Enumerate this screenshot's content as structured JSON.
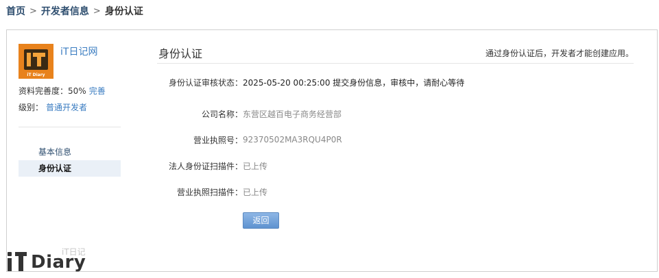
{
  "breadcrumb": {
    "home": "首页",
    "developer_info": "开发者信息",
    "current": "身份认证"
  },
  "sidebar": {
    "site_name": "iT日记网",
    "avatar_caption": "iT Diary",
    "completeness_label": "资料完善度：",
    "completeness_value": "50%",
    "completeness_link": "完善",
    "level_label": "级别：",
    "level_value": "普通开发者",
    "nav": [
      {
        "label": "基本信息",
        "active": false
      },
      {
        "label": "身份认证",
        "active": true
      }
    ]
  },
  "main": {
    "title": "身份认证",
    "note": "通过身份认证后，开发者才能创建应用。",
    "fields": {
      "status_label": "身份认证审核状态：",
      "status_value": "2025-05-20 00:25:00 提交身份信息，审核中，请耐心等待",
      "company_label": "公司名称：",
      "company_value": "东营区越百电子商务经营部",
      "license_label": "营业执照号：",
      "license_value": "92370502MA3RQU4P0R",
      "legal_id_label": "法人身份证扫描件：",
      "legal_id_value": "已上传",
      "license_scan_label": "营业执照扫描件：",
      "license_scan_value": "已上传"
    },
    "back_button": "返回"
  },
  "watermark": {
    "top_text": "iT日记",
    "word": "Diary"
  },
  "colors": {
    "link": "#3a7cc1",
    "breadcrumb": "#2d4d6e",
    "button": "#5f93d0",
    "avatar_bg": "#e8821c"
  }
}
